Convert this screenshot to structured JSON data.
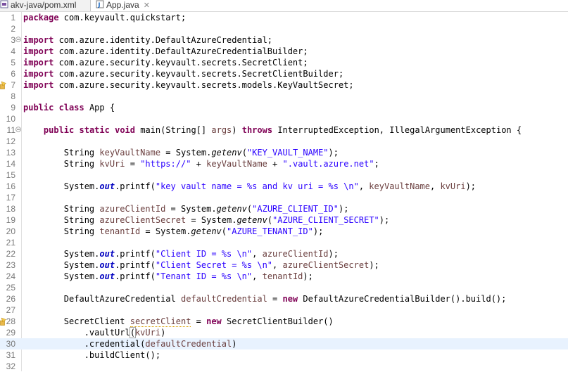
{
  "tabs": [
    {
      "label": "akv-java/pom.xml",
      "active": false,
      "icon": "xml-file-icon"
    },
    {
      "label": "App.java",
      "active": true,
      "icon": "java-file-icon",
      "close": "✕"
    }
  ],
  "editor": {
    "current_line": 30,
    "lines": [
      {
        "n": "1",
        "tokens": [
          {
            "t": "package",
            "c": "kw"
          },
          {
            "t": " com.keyvault.quickstart;"
          }
        ]
      },
      {
        "n": "2",
        "tokens": []
      },
      {
        "n": "3",
        "fold": true,
        "tokens": [
          {
            "t": "import",
            "c": "kw"
          },
          {
            "t": " com.azure.identity.DefaultAzureCredential;"
          }
        ]
      },
      {
        "n": "4",
        "tokens": [
          {
            "t": "import",
            "c": "kw"
          },
          {
            "t": " com.azure.identity.DefaultAzureCredentialBuilder;"
          }
        ]
      },
      {
        "n": "5",
        "tokens": [
          {
            "t": "import",
            "c": "kw"
          },
          {
            "t": " com.azure.security.keyvault.secrets.SecretClient;"
          }
        ]
      },
      {
        "n": "6",
        "tokens": [
          {
            "t": "import",
            "c": "kw"
          },
          {
            "t": " com.azure.security.keyvault.secrets.SecretClientBuilder;"
          }
        ]
      },
      {
        "n": "7",
        "marker": "warning",
        "tokens": [
          {
            "t": "import",
            "c": "kw"
          },
          {
            "t": " com.azure.security.keyvault.secrets.models.KeyVaultSecret;"
          }
        ]
      },
      {
        "n": "8",
        "tokens": []
      },
      {
        "n": "9",
        "tokens": [
          {
            "t": "public",
            "c": "kw"
          },
          {
            "t": " "
          },
          {
            "t": "class",
            "c": "kw"
          },
          {
            "t": " App {"
          }
        ]
      },
      {
        "n": "10",
        "tokens": []
      },
      {
        "n": "11",
        "fold": true,
        "tokens": [
          {
            "t": "    "
          },
          {
            "t": "public",
            "c": "kw"
          },
          {
            "t": " "
          },
          {
            "t": "static",
            "c": "kw"
          },
          {
            "t": " "
          },
          {
            "t": "void",
            "c": "kw"
          },
          {
            "t": " main(String[] "
          },
          {
            "t": "args",
            "c": "loc"
          },
          {
            "t": ") "
          },
          {
            "t": "throws",
            "c": "kw"
          },
          {
            "t": " InterruptedException, IllegalArgumentException {"
          }
        ]
      },
      {
        "n": "12",
        "tokens": []
      },
      {
        "n": "13",
        "tokens": [
          {
            "t": "        String "
          },
          {
            "t": "keyVaultName",
            "c": "loc"
          },
          {
            "t": " = System."
          },
          {
            "t": "getenv",
            "c": "stm"
          },
          {
            "t": "("
          },
          {
            "t": "\"KEY_VAULT_NAME\"",
            "c": "str"
          },
          {
            "t": ");"
          }
        ]
      },
      {
        "n": "14",
        "tokens": [
          {
            "t": "        String "
          },
          {
            "t": "kvUri",
            "c": "loc"
          },
          {
            "t": " = "
          },
          {
            "t": "\"https://\"",
            "c": "str"
          },
          {
            "t": " + "
          },
          {
            "t": "keyVaultName",
            "c": "loc"
          },
          {
            "t": " + "
          },
          {
            "t": "\".vault.azure.net\"",
            "c": "str"
          },
          {
            "t": ";"
          }
        ]
      },
      {
        "n": "15",
        "tokens": []
      },
      {
        "n": "16",
        "tokens": [
          {
            "t": "        System."
          },
          {
            "t": "out",
            "c": "fld"
          },
          {
            "t": ".printf("
          },
          {
            "t": "\"key vault name = %s and kv uri = %s \\n\"",
            "c": "str"
          },
          {
            "t": ", "
          },
          {
            "t": "keyVaultName",
            "c": "loc"
          },
          {
            "t": ", "
          },
          {
            "t": "kvUri",
            "c": "loc"
          },
          {
            "t": ");"
          }
        ]
      },
      {
        "n": "17",
        "tokens": []
      },
      {
        "n": "18",
        "tokens": [
          {
            "t": "        String "
          },
          {
            "t": "azureClientId",
            "c": "loc"
          },
          {
            "t": " = System."
          },
          {
            "t": "getenv",
            "c": "stm"
          },
          {
            "t": "("
          },
          {
            "t": "\"AZURE_CLIENT_ID\"",
            "c": "str"
          },
          {
            "t": ");"
          }
        ]
      },
      {
        "n": "19",
        "tokens": [
          {
            "t": "        String "
          },
          {
            "t": "azureClientSecret",
            "c": "loc"
          },
          {
            "t": " = System."
          },
          {
            "t": "getenv",
            "c": "stm"
          },
          {
            "t": "("
          },
          {
            "t": "\"AZURE_CLIENT_SECRET\"",
            "c": "str"
          },
          {
            "t": ");"
          }
        ]
      },
      {
        "n": "20",
        "tokens": [
          {
            "t": "        String "
          },
          {
            "t": "tenantId",
            "c": "loc"
          },
          {
            "t": " = System."
          },
          {
            "t": "getenv",
            "c": "stm"
          },
          {
            "t": "("
          },
          {
            "t": "\"AZURE_TENANT_ID\"",
            "c": "str"
          },
          {
            "t": ");"
          }
        ]
      },
      {
        "n": "21",
        "tokens": []
      },
      {
        "n": "22",
        "tokens": [
          {
            "t": "        System."
          },
          {
            "t": "out",
            "c": "fld"
          },
          {
            "t": ".printf("
          },
          {
            "t": "\"Client ID = %s \\n\"",
            "c": "str"
          },
          {
            "t": ", "
          },
          {
            "t": "azureClientId",
            "c": "loc"
          },
          {
            "t": ");"
          }
        ]
      },
      {
        "n": "23",
        "tokens": [
          {
            "t": "        System."
          },
          {
            "t": "out",
            "c": "fld"
          },
          {
            "t": ".printf("
          },
          {
            "t": "\"Client Secret = %s \\n\"",
            "c": "str"
          },
          {
            "t": ", "
          },
          {
            "t": "azureClientSecret",
            "c": "loc"
          },
          {
            "t": ");"
          }
        ]
      },
      {
        "n": "24",
        "tokens": [
          {
            "t": "        System."
          },
          {
            "t": "out",
            "c": "fld"
          },
          {
            "t": ".printf("
          },
          {
            "t": "\"Tenant ID = %s \\n\"",
            "c": "str"
          },
          {
            "t": ", "
          },
          {
            "t": "tenantId",
            "c": "loc"
          },
          {
            "t": ");"
          }
        ]
      },
      {
        "n": "25",
        "tokens": []
      },
      {
        "n": "26",
        "tokens": [
          {
            "t": "        DefaultAzureCredential "
          },
          {
            "t": "defaultCredential",
            "c": "loc"
          },
          {
            "t": " = "
          },
          {
            "t": "new",
            "c": "kw"
          },
          {
            "t": " DefaultAzureCredentialBuilder().build();"
          }
        ]
      },
      {
        "n": "27",
        "tokens": []
      },
      {
        "n": "28",
        "marker": "warning",
        "tokens": [
          {
            "t": "        SecretClient "
          },
          {
            "t": "secretClient",
            "c": "loc unused"
          },
          {
            "t": " = "
          },
          {
            "t": "new",
            "c": "kw"
          },
          {
            "t": " SecretClientBuilder()"
          }
        ]
      },
      {
        "n": "29",
        "tokens": [
          {
            "t": "            .vaultUrl"
          },
          {
            "t": "(",
            "c": "match"
          },
          {
            "t": "kvUri",
            "c": "loc"
          },
          {
            "t": ")"
          }
        ]
      },
      {
        "n": "30",
        "tokens": [
          {
            "t": "            .credential("
          },
          {
            "t": "defaultCredential",
            "c": "loc"
          },
          {
            "t": ")"
          }
        ]
      },
      {
        "n": "31",
        "tokens": [
          {
            "t": "            .buildClient();"
          }
        ]
      },
      {
        "n": "32",
        "tokens": []
      }
    ]
  }
}
